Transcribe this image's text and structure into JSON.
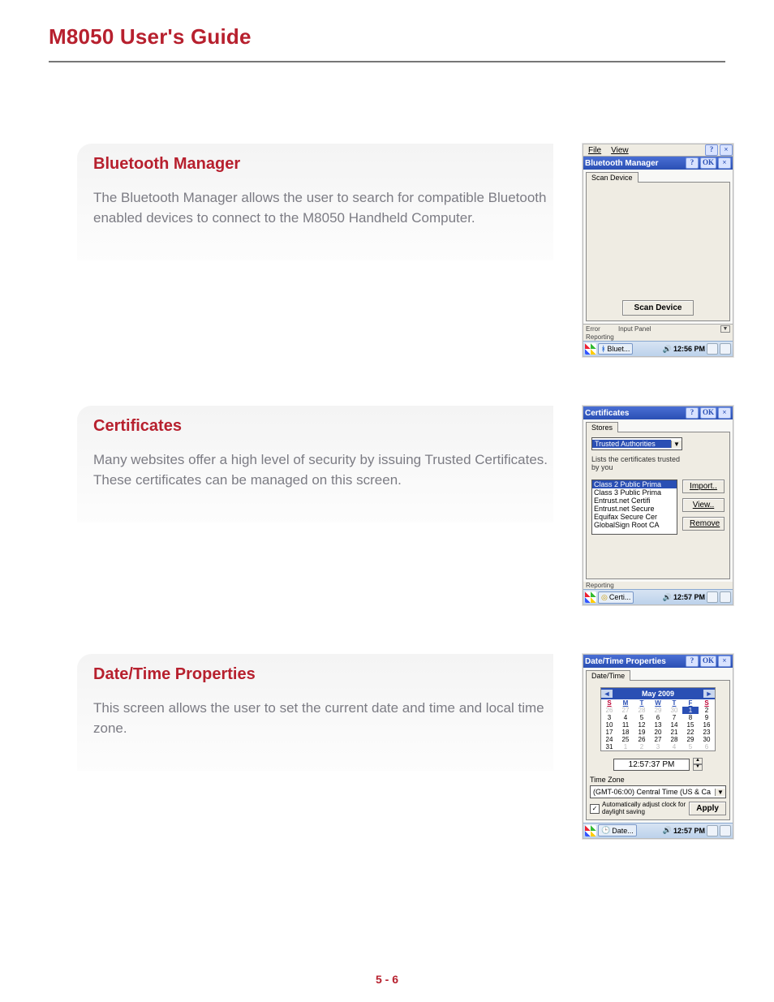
{
  "header": {
    "title": "M8050 User's Guide"
  },
  "page_number": "5 - 6",
  "sections": {
    "bluetooth": {
      "heading": "Bluetooth Manager",
      "body": "The Bluetooth Manager allows the user to search for compatible Bluetooth enabled devices to connect to the M8050 Handheld Computer."
    },
    "certificates": {
      "heading": "Certificates",
      "body": "Many websites offer a high level of security by issuing Trusted Certificates. These certificates can be managed on this screen."
    },
    "datetime": {
      "heading": "Date/Time Properties",
      "body": "This screen allows the user to set the current date and time and local time zone."
    }
  },
  "shot_bt": {
    "appbar_file": "File",
    "appbar_view": "View",
    "title": "Bluetooth Manager",
    "help": "?",
    "ok": "OK",
    "close": "×",
    "tab": "Scan Device",
    "scan_button": "Scan Device",
    "behind_error": "Error",
    "behind_reporting": "Reporting",
    "behind_input_panel": "Input Panel",
    "task_label": "Bluet...",
    "clock": "12:56 PM"
  },
  "shot_cert": {
    "title": "Certificates",
    "help": "?",
    "ok": "OK",
    "close": "×",
    "tab": "Stores",
    "combo_label": "Trusted Authorities",
    "desc": "Lists the certificates trusted by you",
    "list": [
      "Class 2 Public Prima",
      "Class 3 Public Prima",
      "Entrust.net Certifi",
      "Entrust.net Secure",
      "Equifax Secure Cer",
      "GlobalSign Root CA"
    ],
    "btn_import": "Import..",
    "btn_view": "View..",
    "btn_remove": "Remove",
    "behind_reporting": "Reporting",
    "task_label": "Certi...",
    "clock": "12:57 PM"
  },
  "shot_dt": {
    "title": "Date/Time Properties",
    "help": "?",
    "ok": "OK",
    "close": "×",
    "tab": "Date/Time",
    "cal_title": "May 2009",
    "dow": [
      "S",
      "M",
      "T",
      "W",
      "T",
      "F",
      "S"
    ],
    "prev_days": [
      "26",
      "27",
      "28",
      "29",
      "30"
    ],
    "today": "1",
    "days_after_today": [
      "2",
      "3",
      "4",
      "5",
      "6",
      "7",
      "8",
      "9",
      "10",
      "11",
      "12",
      "13",
      "14",
      "15",
      "16",
      "17",
      "18",
      "19",
      "20",
      "21",
      "22",
      "23",
      "24",
      "25",
      "26",
      "27",
      "28",
      "29",
      "30",
      "31"
    ],
    "next_days": [
      "1",
      "2",
      "3",
      "4",
      "5",
      "6"
    ],
    "time_value": "12:57:37 PM",
    "tz_label": "Time Zone",
    "tz_value": "(GMT-06:00) Central Time (US & Ca",
    "dst_label": "Automatically adjust clock for daylight saving",
    "apply": "Apply",
    "task_label": "Date...",
    "clock": "12:57 PM"
  }
}
